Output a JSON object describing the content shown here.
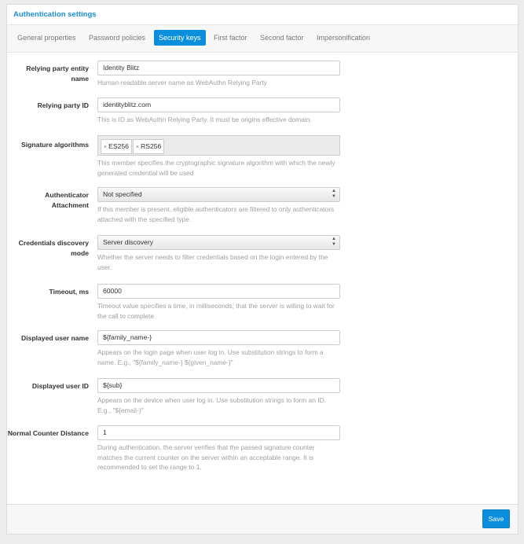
{
  "header": {
    "title": "Authentication settings"
  },
  "tabs": [
    {
      "label": "General properties"
    },
    {
      "label": "Password policies"
    },
    {
      "label": "Security keys",
      "active": true
    },
    {
      "label": "First factor"
    },
    {
      "label": "Second factor"
    },
    {
      "label": "Impersonification"
    }
  ],
  "fields": {
    "rp_name": {
      "label": "Relying party entity name",
      "value": "Identity Blitz",
      "help": "Human-readable server name as WebAuthn Relying Party"
    },
    "rp_id": {
      "label": "Relying party ID",
      "value": "identityblitz.com",
      "help": "This is ID as WebAuthn Relying Party. It must be origins effective domain."
    },
    "sig_alg": {
      "label": "Signature algorithms",
      "tags": [
        "ES256",
        "RS256"
      ],
      "help": "This member specifies the cryptographic signature algorithm with which the newly generated credential will be used"
    },
    "attachment": {
      "label": "Authenticator Attachment",
      "value": "Not specified",
      "help": "If this member is present, eligible authenticators are filtered to only authenticators attached with the specified type."
    },
    "discovery": {
      "label": "Credentials discovery mode",
      "value": "Server discovery",
      "help": "Whether the server needs to filter credentials based on the login entered by the user."
    },
    "timeout": {
      "label": "Timeout, ms",
      "value": "60000",
      "help": "Timeout value specifies a time, in milliseconds, that the server is willing to wait for the call to complete"
    },
    "user_name": {
      "label": "Displayed user name",
      "value": "${family_name-}",
      "help": "Appears on the login page when user log in. Use substitution strings to form a name. E.g., \"${family_name-} ${given_name-}\""
    },
    "user_id": {
      "label": "Displayed user ID",
      "value": "${sub}",
      "help": "Appears on the device when user log in. Use substitution strings to form an ID. E.g., \"${email-}\""
    },
    "counter": {
      "label": "Normal Counter Distance",
      "value": "1",
      "help": "During authentication, the server verifies that the passed signature counter matches the current counter on the server within an acceptable range. It is recommended to set the range to 1."
    }
  },
  "footer": {
    "save_label": "Save"
  },
  "colors": {
    "accent": "#0b8fdc"
  }
}
